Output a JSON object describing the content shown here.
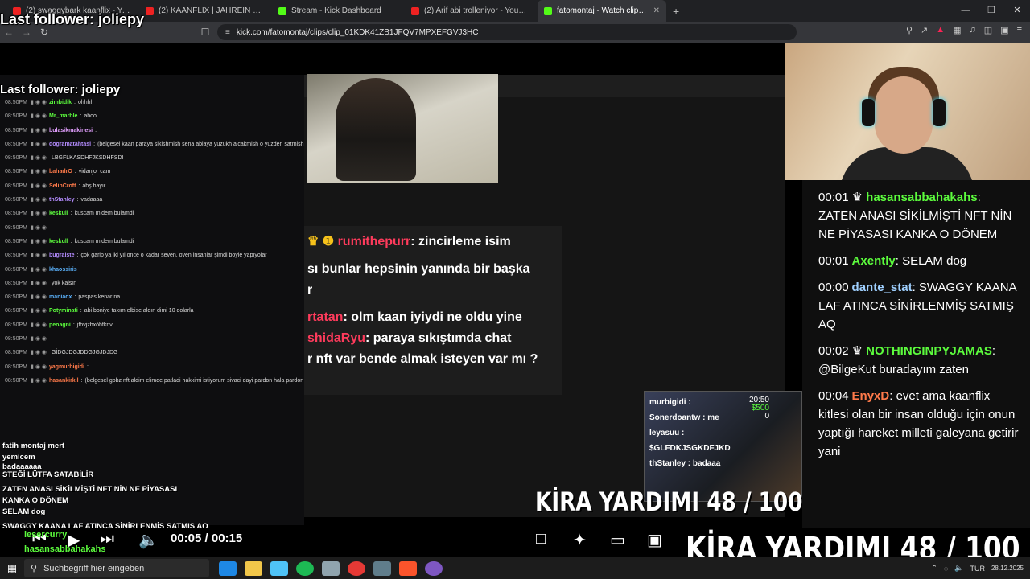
{
  "browser": {
    "tabs": [
      {
        "title": "(2) swaggybark kaanflix - YouTube",
        "icon": "youtube"
      },
      {
        "title": "(2) KAANFLIX | JAHREIN VE SWAGGY",
        "icon": "youtube"
      },
      {
        "title": "Stream - Kick Dashboard",
        "icon": "kick"
      },
      {
        "title": "(2) Arif abi trolleniyor - YouTube",
        "icon": "youtube"
      },
      {
        "title": "fatomontaj - Watch clips on K",
        "icon": "kick"
      }
    ],
    "url": "kick.com/fatomontaj/clips/clip_01KDK41ZB1JFQV7MPXEFGVJ3HC"
  },
  "overlay": {
    "last_follower": "Last follower: joliepy"
  },
  "left_chat": [
    {
      "time": "08:50PM",
      "user": "zimbidik",
      "color": "#5cfc3d",
      "text": "ohhhh"
    },
    {
      "time": "08:50PM",
      "user": "Mr_marble",
      "color": "#5cfc3d",
      "text": "aboo"
    },
    {
      "time": "08:50PM",
      "user": "bulasikmakinesi",
      "color": "#e3a0ff",
      "text": ""
    },
    {
      "time": "08:50PM",
      "user": "dogramatahtasi",
      "color": "#b48cff",
      "text": "(belgesel kaan paraya sikishmish sena ablaya yuzukh alcakmish o yuzden satmish yazıklar olsun rusthu kaan varli"
    },
    {
      "time": "08:50PM",
      "user": "",
      "color": "#ff5a6a",
      "text": "LBGFLKASDHFJKSDHFSDI"
    },
    {
      "time": "08:50PM",
      "user": "bahadrO",
      "color": "#ff7a4a",
      "text": "vidanjor cam"
    },
    {
      "time": "08:50PM",
      "user": "SelinCroft",
      "color": "#ff7a4a",
      "text": "abş hayır"
    },
    {
      "time": "08:50PM",
      "user": "thStanley",
      "color": "#b48cff",
      "text": "vadaaaa"
    },
    {
      "time": "08:50PM",
      "user": "keskull",
      "color": "#5cfc3d",
      "text": "kuscam midem bulamdi"
    },
    {
      "time": "08:50PM",
      "user": "",
      "color": "#ff5a6a",
      "text": ""
    },
    {
      "time": "08:50PM",
      "user": "keskull",
      "color": "#5cfc3d",
      "text": "kuscam midem bulamdi"
    },
    {
      "time": "08:50PM",
      "user": "bugraiste",
      "color": "#b48cff",
      "text": "çok garip ya iki yıl önce o kadar seven, öven insanlar şimdi böyle yapıyolar"
    },
    {
      "time": "08:50PM",
      "user": "khaossiris",
      "color": "#5cb4ff",
      "text": ""
    },
    {
      "time": "08:50PM",
      "user": "",
      "color": "#5cb4ff",
      "text": "yok kalsın"
    },
    {
      "time": "08:50PM",
      "user": "maniaqx",
      "color": "#5cb4ff",
      "text": "paspas kenarına"
    },
    {
      "time": "08:50PM",
      "user": "Potyminati",
      "color": "#5cfc3d",
      "text": "abi boniye takım elbise aldın dimi 10 dolarla"
    },
    {
      "time": "08:50PM",
      "user": "penagni",
      "color": "#5cfc3d",
      "text": "jfhvjzbxöhfknv"
    },
    {
      "time": "08:50PM",
      "user": "",
      "color": "#ff5a6a",
      "text": ""
    },
    {
      "time": "08:50PM",
      "user": "",
      "color": "#ff5a6a",
      "text": "GİDGJDGJDDGJGJDJDG"
    },
    {
      "time": "08:50PM",
      "user": "yagmurbigidi",
      "color": "#ff7a4a",
      "text": ""
    },
    {
      "time": "08:50PM",
      "user": "hasankirkil",
      "color": "#ff7a4a",
      "text": "(belgesel gobz nft aldim elimde patladi hakkimi istiyorum sivaci dayi pardon hala pardon dayi"
    }
  ],
  "overlay_chat": [
    {
      "user": "rumithepurr",
      "text": "zincirleme isim"
    },
    {
      "user": "",
      "text": "sı bunlar hepsinin yanında bir başka"
    },
    {
      "user": "",
      "text": "r"
    },
    {
      "user": "rtatan",
      "text": "olm kaan iyiydi ne oldu yine"
    },
    {
      "user": "shidaRyu",
      "text": "paraya sıkıştımda chat"
    },
    {
      "user": "",
      "text": "r nft var bende almak isteyen var mı ?"
    }
  ],
  "pip": {
    "chat": [
      "murbigidi :",
      "Sonerdoantw : me",
      "leyasuu :",
      "$GLFDKJSGKDFJKD",
      "thStanley : badaaa"
    ],
    "time": "20:50",
    "money": "$500",
    "count": "0"
  },
  "kira": "KİRA YARDIMI  48 / 100",
  "stream_chat": [
    {
      "time": "00:01",
      "user": "hasansabbahakahs",
      "color": "#5cfc3d",
      "badges": "crown",
      "text": "ZATEN ANASI SİKİLMİŞTİ NFT NİN NE PİYASASI KANKA O DÖNEM"
    },
    {
      "time": "00:01",
      "user": "Axently",
      "color": "#5cfc3d",
      "badges": "",
      "text": "SELAM dog"
    },
    {
      "time": "00:00",
      "user": "dante_stat",
      "color": "#9fd0ff",
      "badges": "",
      "text": "SWAGGY KAANA LAF ATINCA SİNİRLENMİŞ SATMIŞ AQ"
    },
    {
      "time": "00:02",
      "user": "NOTHINGINPYJAMAS",
      "color": "#5cfc3d",
      "badges": "crown",
      "text": "@BilgeKut buradayım zaten"
    },
    {
      "time": "00:04",
      "user": "EnyxD",
      "color": "#ff7a4a",
      "badges": "",
      "text": "evet ama kaanflix kitlesi olan bir insan olduğu için onun yaptığı hareket milleti galeyana getirir yani"
    }
  ],
  "lower_strip": [
    "fatih montaj mert",
    "yemicem",
    "badaaaaaa",
    "STEĞİ LÜTFA SATABİLİR",
    "ZATEN ANASI SİKİLMİŞTİ NFT NİN NE PİYASASI",
    "KANKA O DÖNEM",
    "SELAM dog",
    "SWAGGY KAANA LAF ATINCA SİNİRLENMİŞ SATMIŞ AQ",
    "@BilgeKut buradayım zaten"
  ],
  "player": {
    "time": "00:05 / 00:15",
    "bottom_lines": [
      {
        "user": "lesercurry",
        "color": "#5cfc3d"
      },
      {
        "user": "hasansabbahakahs",
        "color": "#5cfc3d"
      }
    ]
  },
  "taskbar": {
    "search_placeholder": "Suchbegriff hier eingeben",
    "lang": "TUR",
    "date": "28.12.2025"
  }
}
